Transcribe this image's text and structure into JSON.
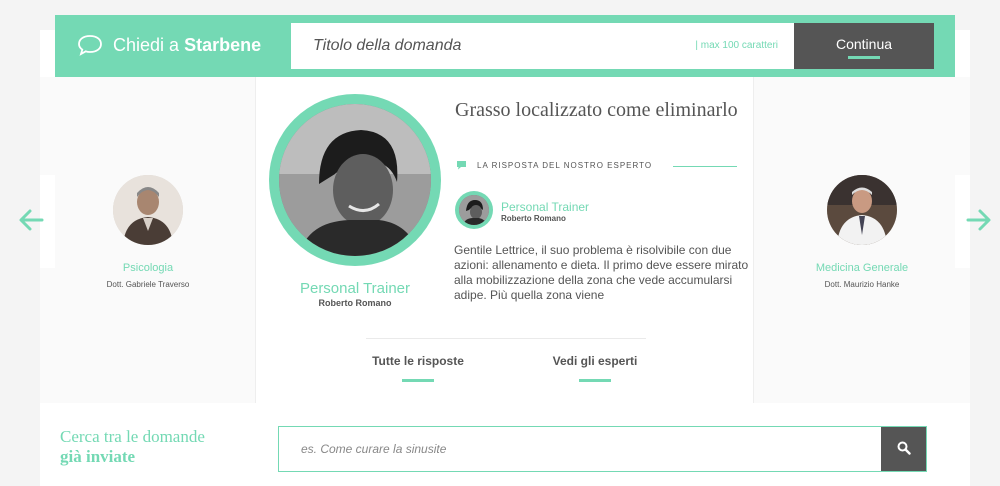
{
  "ask": {
    "brand_prefix": "Chiedi a",
    "brand_name": "Starbene",
    "placeholder": "Titolo della domanda",
    "limit": "| max 100 caratteri",
    "continue_label": "Continua"
  },
  "experts_side": {
    "left": {
      "specialty": "Psicologia",
      "name": "Dott. Gabriele Traverso"
    },
    "right": {
      "specialty": "Medicina Generale",
      "name": "Dott. Maurizio Hanke"
    }
  },
  "featured": {
    "specialty": "Personal Trainer",
    "name": "Roberto Romano",
    "question_title": "Grasso localizzato come eliminarlo",
    "answer_tag": "LA RISPOSTA DEL NOSTRO ESPERTO",
    "answer_text": "Gentile Lettrice, il suo problema è risolvibile con due azioni: allenamento e dieta. Il primo deve essere mirato alla mobilizzazione della zona che vede accumularsi adipe. Più quella zona viene"
  },
  "actions": {
    "all_answers": "Tutte le risposte",
    "see_experts": "Vedi gli esperti"
  },
  "search": {
    "heading_line1": "Cerca tra le domande",
    "heading_line2": "già inviate",
    "placeholder": "es. Come curare la sinusite"
  },
  "colors": {
    "accent": "#74d9b4",
    "dark": "#555555"
  },
  "icons": {
    "brand": "chat-bubble-icon",
    "tag": "speech-icon",
    "prev": "arrow-left-icon",
    "next": "arrow-right-icon",
    "search": "search-icon"
  }
}
